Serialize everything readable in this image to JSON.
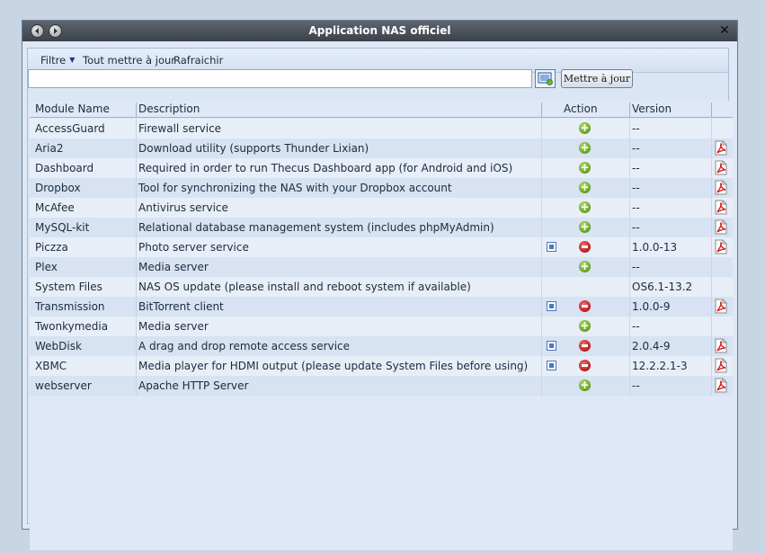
{
  "window": {
    "title": "Application NAS officiel"
  },
  "toolbar": {
    "filter_label": "Filtre",
    "update_all_label": "Tout mettre à jour",
    "refresh_label": "Rafraichir"
  },
  "search": {
    "value": "",
    "update_button_label": "Mettre à jour"
  },
  "columns": {
    "name": "Module Name",
    "description": "Description",
    "action": "Action",
    "version": "Version"
  },
  "rows": [
    {
      "name": "AccessGuard",
      "description": "Firewall service",
      "version": "--",
      "action": "install",
      "settings": false,
      "pdf": false
    },
    {
      "name": "Aria2",
      "description": "Download utility (supports Thunder Lixian)",
      "version": "--",
      "action": "install",
      "settings": false,
      "pdf": true
    },
    {
      "name": "Dashboard",
      "description": "Required in order to run Thecus Dashboard app (for Android and iOS)",
      "version": "--",
      "action": "install",
      "settings": false,
      "pdf": true
    },
    {
      "name": "Dropbox",
      "description": "Tool for synchronizing the NAS with your Dropbox account",
      "version": "--",
      "action": "install",
      "settings": false,
      "pdf": true
    },
    {
      "name": "McAfee",
      "description": "Antivirus service",
      "version": "--",
      "action": "install",
      "settings": false,
      "pdf": true
    },
    {
      "name": "MySQL-kit",
      "description": "Relational database management system (includes phpMyAdmin)",
      "version": "--",
      "action": "install",
      "settings": false,
      "pdf": true
    },
    {
      "name": "Piczza",
      "description": "Photo server service",
      "version": "1.0.0-13",
      "action": "remove",
      "settings": true,
      "pdf": true
    },
    {
      "name": "Plex",
      "description": "Media server",
      "version": "--",
      "action": "install",
      "settings": false,
      "pdf": false
    },
    {
      "name": "System Files",
      "description": "NAS OS update (please install and reboot system if available)",
      "version": "OS6.1-13.2",
      "action": "none",
      "settings": false,
      "pdf": false
    },
    {
      "name": "Transmission",
      "description": "BitTorrent client",
      "version": "1.0.0-9",
      "action": "remove",
      "settings": true,
      "pdf": true
    },
    {
      "name": "Twonkymedia",
      "description": "Media server",
      "version": "--",
      "action": "install",
      "settings": false,
      "pdf": false
    },
    {
      "name": "WebDisk",
      "description": "A drag and drop remote access service",
      "version": "2.0.4-9",
      "action": "remove",
      "settings": true,
      "pdf": true
    },
    {
      "name": "XBMC",
      "description": "Media player for HDMI output (please update System Files before using)",
      "version": "12.2.2.1-3",
      "action": "remove",
      "settings": true,
      "pdf": true
    },
    {
      "name": "webserver",
      "description": "Apache HTTP Server",
      "version": "--",
      "action": "install",
      "settings": false,
      "pdf": true
    }
  ]
}
